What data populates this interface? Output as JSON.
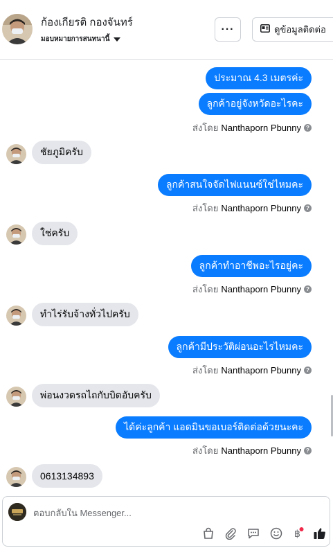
{
  "header": {
    "contact_name": "ก้องเกียรติ กองจันทร์",
    "assign_label": "มอบหมายการสนทนานี้",
    "more_label": "···",
    "contact_info_label": "ดูข้อมูลติดต่อ"
  },
  "thread": {
    "sent_by_prefix": "ส่งโดย",
    "messages": [
      {
        "direction": "out",
        "text": "ประมาณ 4.3 เมตรค่ะ"
      },
      {
        "direction": "out",
        "text": "ลูกค้าอยู่จังหวัดอะไรคะ",
        "sender": "Nanthaporn Pbunny"
      },
      {
        "direction": "in",
        "text": "ชัยภูมิครับ"
      },
      {
        "direction": "out",
        "text": "ลูกค้าสนใจจัดไฟแนนซ์ใช่ไหมคะ",
        "sender": "Nanthaporn Pbunny"
      },
      {
        "direction": "in",
        "text": "ใช่ครับ"
      },
      {
        "direction": "out",
        "text": "ลูกค้าทำอาชีพอะไรอยู่คะ",
        "sender": "Nanthaporn Pbunny"
      },
      {
        "direction": "in",
        "text": "ทำไร่รับจ้างทั่วไปครับ"
      },
      {
        "direction": "out",
        "text": "ลูกค้ามีประวัติผ่อนอะไรไหมคะ",
        "sender": "Nanthaporn Pbunny"
      },
      {
        "direction": "in",
        "text": "พ่อนงวดรถไถกับบิดอับครับ"
      },
      {
        "direction": "out",
        "text": "ได้ค่ะลูกค้า แอดมินขอเบอร์ติดต่อด้วยนะคะ",
        "sender": "Nanthaporn Pbunny"
      },
      {
        "direction": "in",
        "text": "0613134893"
      }
    ]
  },
  "composer": {
    "placeholder": "ตอบกลับใน Messenger...",
    "tools": [
      "shopping-bag-icon",
      "paperclip-icon",
      "saved-reply-icon",
      "emoji-icon",
      "baht-payment-icon",
      "like-icon"
    ]
  },
  "colors": {
    "outgoing_bubble": "#0a7cff",
    "incoming_bubble": "#e4e6eb",
    "notification_dot": "#f02849"
  }
}
